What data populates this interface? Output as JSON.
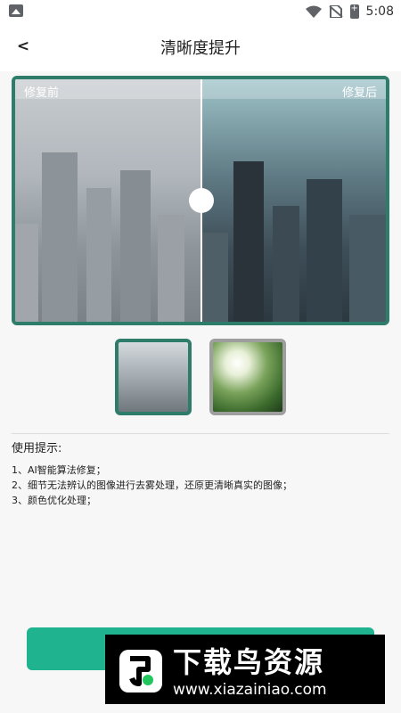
{
  "status_bar": {
    "time": "5:08"
  },
  "app_bar": {
    "back_label": "<",
    "title": "清晰度提升"
  },
  "compare": {
    "before_label": "修复前",
    "after_label": "修复后"
  },
  "thumbnails": [
    {
      "name": "city-haze"
    },
    {
      "name": "forest-fog"
    }
  ],
  "tips": {
    "heading": "使用提示:",
    "items": [
      "1、AI智能算法修复；",
      "2、细节无法辨认的图像进行去雾处理，还原更清晰真实的图像；",
      "3、颜色优化处理；"
    ]
  },
  "watermark": {
    "name": "下载鸟资源",
    "url": "www.xiazainiao.com"
  },
  "colors": {
    "accent": "#1fb48f",
    "frame": "#2e7d6a"
  }
}
